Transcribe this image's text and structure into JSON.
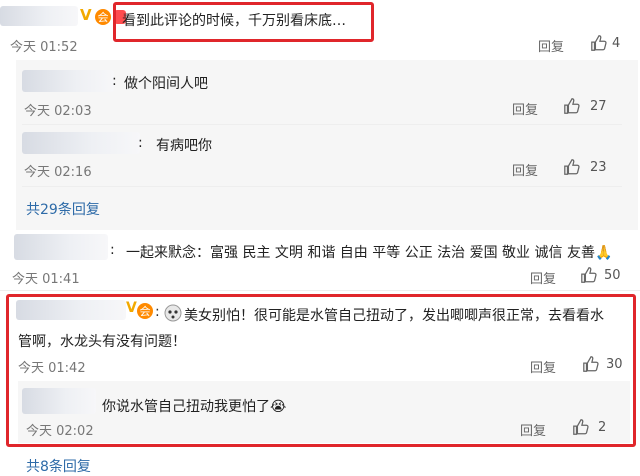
{
  "comments": [
    {
      "text": "看到此评论的时候，千万别看床底…",
      "time": "今天 01:52",
      "reply": "回复",
      "likes": "4"
    },
    {
      "text": "一起来默念：富强 民主 文明 和谐 自由 平等 公正 法治 爱国 敬业 诚信 友善🙏",
      "time": "今天 01:41",
      "reply": "回复",
      "likes": "50"
    },
    {
      "text_line1": "美女别怕！很可能是水管自己扭动了，发出唧唧声很正常，去看看水",
      "text_line2": "管啊，水龙头有没有问题！",
      "time": "今天 01:42",
      "reply": "回复",
      "likes": "30"
    }
  ],
  "sub_replies_1": [
    {
      "text": "做个阳间人吧",
      "time": "今天 02:03",
      "reply": "回复",
      "likes": "27"
    },
    {
      "text": "有病吧你",
      "time": "今天 02:16",
      "reply": "回复",
      "likes": "23"
    }
  ],
  "more_replies_link": "共29条回复",
  "sub_replies_3": [
    {
      "text": "你说水管自己扭动我更怕了😭",
      "time": "今天 02:02",
      "reply": "回复",
      "likes": "2"
    }
  ],
  "bottom_partial": "共8条回复",
  "colors": {
    "highlight": "#e0262b",
    "link": "#2e6ba8",
    "sub_bg": "#f6f6f6"
  }
}
